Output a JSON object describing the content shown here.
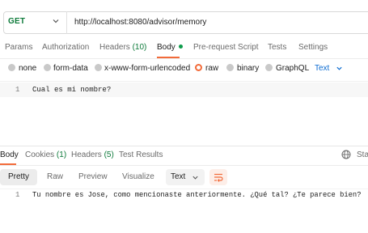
{
  "request": {
    "method": "GET",
    "url": "http://localhost:8080/advisor/memory"
  },
  "request_tabs": [
    {
      "label": "Params"
    },
    {
      "label": "Authorization"
    },
    {
      "label": "Headers",
      "count": "(10)"
    },
    {
      "label": "Body",
      "active": true
    },
    {
      "label": "Pre-request Script"
    },
    {
      "label": "Tests"
    },
    {
      "label": "Settings"
    }
  ],
  "body_types": [
    {
      "label": "none"
    },
    {
      "label": "form-data"
    },
    {
      "label": "x-www-form-urlencoded"
    },
    {
      "label": "raw",
      "selected": true
    },
    {
      "label": "binary"
    },
    {
      "label": "GraphQL"
    }
  ],
  "raw_format": "Text",
  "request_body": {
    "line_number": "1",
    "content": "Cual es mi nombre?"
  },
  "response_tabs": [
    {
      "label": "Body",
      "active": true
    },
    {
      "label": "Cookies",
      "count": "(1)"
    },
    {
      "label": "Headers",
      "count": "(5)"
    },
    {
      "label": "Test Results"
    }
  ],
  "response_status_partial": "Sta",
  "response_views": [
    {
      "label": "Pretty",
      "active": true
    },
    {
      "label": "Raw"
    },
    {
      "label": "Preview"
    },
    {
      "label": "Visualize"
    }
  ],
  "response_format": "Text",
  "response_body": {
    "line_number": "1",
    "content": "Tu nombre es Jose, como mencionaste anteriormente. ¿Qué tal? ¿Te parece bien?"
  },
  "colors": {
    "accent": "#f26b3a",
    "method_green": "#0d7a3a",
    "link_blue": "#0b6bd1"
  },
  "icons": [
    "chevron-down-icon",
    "globe-icon",
    "wrap-lines-icon"
  ]
}
